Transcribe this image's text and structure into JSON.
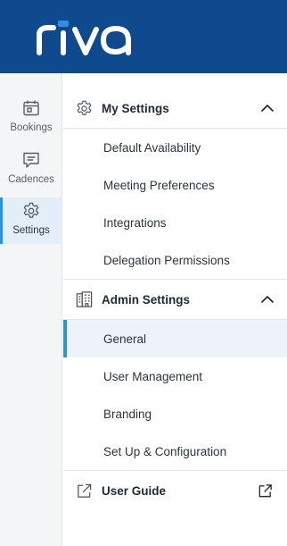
{
  "brand": {
    "logo_text": "riva",
    "header_color": "#0f4a8f"
  },
  "rail": {
    "items": [
      {
        "label": "Bookings",
        "icon": "calendar-icon",
        "active": false
      },
      {
        "label": "Cadences",
        "icon": "message-icon",
        "active": false
      },
      {
        "label": "Settings",
        "icon": "gear-icon",
        "active": true
      }
    ]
  },
  "my_settings": {
    "title": "My Settings",
    "icon": "gear-icon",
    "expanded": true,
    "items": [
      {
        "label": "Default Availability"
      },
      {
        "label": "Meeting Preferences"
      },
      {
        "label": "Integrations"
      },
      {
        "label": "Delegation Permissions"
      }
    ]
  },
  "admin_settings": {
    "title": "Admin Settings",
    "icon": "building-icon",
    "expanded": true,
    "items": [
      {
        "label": "General",
        "active": true
      },
      {
        "label": "User Management"
      },
      {
        "label": "Branding"
      },
      {
        "label": "Set Up & Configuration"
      }
    ]
  },
  "user_guide": {
    "label": "User Guide",
    "icon": "external-link-icon"
  },
  "colors": {
    "accent": "#2f8ee5",
    "active_bg": "#eef3f9"
  }
}
